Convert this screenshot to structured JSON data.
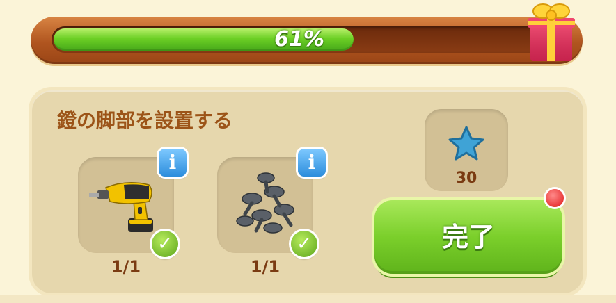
{
  "progress": {
    "value": 0.61,
    "label": "61%"
  },
  "task": {
    "title": "鐙の脚部を設置する",
    "items": [
      {
        "name": "drill",
        "icon": "power-drill-icon",
        "count": "1/1",
        "completed": true
      },
      {
        "name": "screws",
        "icon": "screws-icon",
        "count": "1/1",
        "completed": true
      }
    ],
    "reward": {
      "icon": "blue-star-icon",
      "value": "30"
    },
    "complete_button": "完了"
  },
  "colors": {
    "progress_fill": "#6ccf25",
    "bar_frame": "#b0551f",
    "panel": "#e6d7ad",
    "title_text": "#9c5418",
    "button_green": "#7bcf2b",
    "notification": "#e01818"
  }
}
